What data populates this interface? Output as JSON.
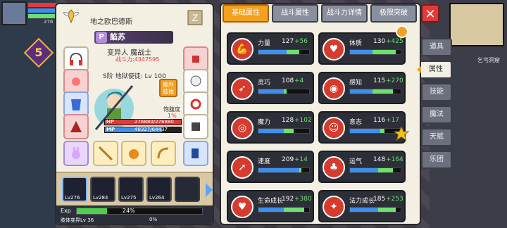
{
  "hud": {
    "level": "5",
    "level_small": "276",
    "map_name": "乞丐洞窟"
  },
  "character": {
    "title": "地之欧巴德斯",
    "subname": "餡苏",
    "subname_badge": "P",
    "class_line": "变异人 魔战士",
    "power_line": "战斗力:4347595",
    "level_line": "S阶 地狱使徒: Lv 100",
    "extra_button": "额外\n肢体",
    "satiety_label": "饱腹度",
    "satiety_value": "1%",
    "bars": [
      {
        "tag": "HP",
        "text": "276880/276880",
        "fraction": 1.0,
        "color": "#e23a3a"
      },
      {
        "tag": "MP",
        "text": "48327/64437",
        "fraction": 0.75,
        "color": "#3d8ff0"
      }
    ]
  },
  "party": [
    {
      "lv": "Lv276",
      "state": "active"
    },
    {
      "lv": "Lv284",
      "state": "dim"
    },
    {
      "lv": "Lv275",
      "state": "dim"
    },
    {
      "lv": "Lv264",
      "state": "dim"
    },
    {
      "lv": "",
      "state": "empty"
    }
  ],
  "exp": {
    "label": "Exp",
    "percent_text": "24%",
    "fraction": 0.24,
    "sub_label": "肢体变异Lv 36",
    "sub_percent": "0%"
  },
  "tabs": [
    {
      "label": "基础属性",
      "active": true
    },
    {
      "label": "战斗属性",
      "active": false
    },
    {
      "label": "战斗力详情",
      "active": false
    },
    {
      "label": "极限突破",
      "active": false
    }
  ],
  "side_tabs": [
    {
      "label": "道具",
      "active": false
    },
    {
      "label": "属性",
      "active": true
    },
    {
      "label": "技能",
      "active": false
    },
    {
      "label": "魔法",
      "active": false
    },
    {
      "label": "天赋",
      "active": false
    },
    {
      "label": "乐团",
      "active": false
    }
  ],
  "attributes": [
    {
      "name": "力量",
      "value": "127",
      "bonus": "+56",
      "base": 0.55,
      "extra": 0.25,
      "icon": "strength-icon",
      "glyph": "💪"
    },
    {
      "name": "体质",
      "value": "130",
      "bonus": "+425",
      "base": 0.45,
      "extra": 0.45,
      "icon": "constitution-icon",
      "glyph": "♥"
    },
    {
      "name": "灵巧",
      "value": "108",
      "bonus": "+4",
      "base": 0.5,
      "extra": 0.05,
      "icon": "agility-icon",
      "glyph": "➶"
    },
    {
      "name": "感知",
      "value": "115",
      "bonus": "+270",
      "base": 0.45,
      "extra": 0.4,
      "icon": "perception-icon",
      "glyph": "◉"
    },
    {
      "name": "魔力",
      "value": "128",
      "bonus": "+102",
      "base": 0.5,
      "extra": 0.2,
      "icon": "magic-icon",
      "glyph": "◎"
    },
    {
      "name": "意志",
      "value": "116",
      "bonus": "+17",
      "base": 0.6,
      "extra": 0.08,
      "icon": "will-icon",
      "glyph": "☺"
    },
    {
      "name": "速度",
      "value": "209",
      "bonus": "+14",
      "base": 0.8,
      "extra": 0.05,
      "icon": "speed-icon",
      "glyph": "➚"
    },
    {
      "name": "运气",
      "value": "148",
      "bonus": "+164",
      "base": 0.55,
      "extra": 0.3,
      "icon": "luck-icon",
      "glyph": "♣"
    },
    {
      "name": "生命成长",
      "value": "192",
      "bonus": "+380",
      "base": 0.5,
      "extra": 0.4,
      "icon": "life-growth-icon",
      "glyph": "♥"
    },
    {
      "name": "法力成长",
      "value": "185",
      "bonus": "+253",
      "base": 0.55,
      "extra": 0.35,
      "icon": "mana-growth-icon",
      "glyph": "✦"
    }
  ],
  "colors": {
    "accent": "#f4a020",
    "attr_bg": "#2c2e38",
    "attr_icon": "#d63b2e",
    "bonus": "#6fe06f"
  }
}
